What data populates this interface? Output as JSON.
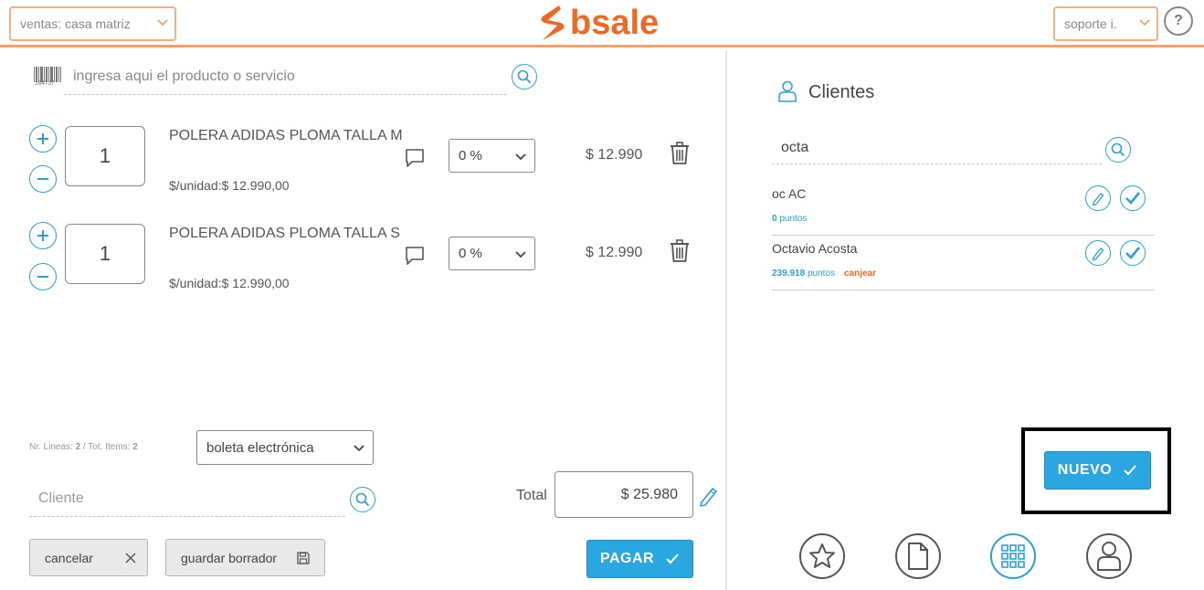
{
  "header": {
    "branch_select": "ventas: casa matriz",
    "logo_text": "bsale",
    "user_select": "soporte i.",
    "help_label": "?"
  },
  "product_search": {
    "placeholder": "ingresa aqui el producto o servicio",
    "barcode_text": "164737"
  },
  "cart": {
    "items": [
      {
        "qty": "1",
        "name": "POLERA ADIDAS PLOMA TALLA M",
        "unit_price": "$/unidad:$ 12.990,00",
        "discount": "0 %",
        "price": "$ 12.990"
      },
      {
        "qty": "1",
        "name": "POLERA ADIDAS PLOMA TALLA S",
        "unit_price": "$/unidad:$ 12.990,00",
        "discount": "0 %",
        "price": "$ 12.990"
      }
    ],
    "summary_prefix1": "Nr. Lineas: ",
    "lines_count": "2",
    "summary_prefix2": " / Tot. Items: ",
    "items_count": "2",
    "document_type": "boleta electrónica",
    "client_placeholder": "Cliente",
    "total_label": "Total",
    "total_value": "$ 25.980",
    "cancel_label": "cancelar",
    "draft_label": "guardar borrador",
    "pay_label": "PAGAR"
  },
  "clients_panel": {
    "title": "Clientes",
    "search_value": "octa",
    "results": [
      {
        "name": "oc AC",
        "points": "0",
        "points_label": "puntos",
        "redeem": ""
      },
      {
        "name": "Octavio Acosta",
        "points": "239.918",
        "points_label": "puntos",
        "redeem": "canjear"
      }
    ],
    "new_label": "NUEVO"
  },
  "bottom_nav": [
    "star-icon",
    "document-icon",
    "grid-icon",
    "user-icon"
  ],
  "colors": {
    "brand_orange": "#ec6a26",
    "accent_blue": "#2aa6e0",
    "highlight_frame": "#000000"
  }
}
